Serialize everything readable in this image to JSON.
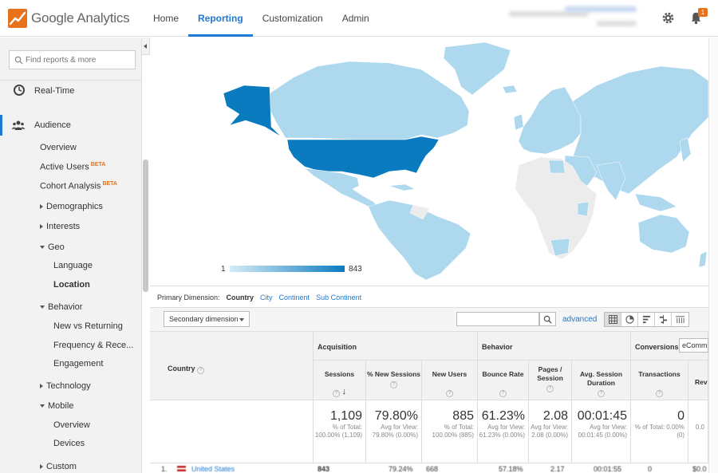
{
  "app": {
    "title": "Google Analytics"
  },
  "nav": {
    "home": "Home",
    "reporting": "Reporting",
    "customization": "Customization",
    "admin": "Admin"
  },
  "notifications": {
    "count": "1"
  },
  "sidebar": {
    "search_placeholder": "Find reports & more",
    "realtime": "Real-Time",
    "audience": "Audience",
    "overview": "Overview",
    "active_users": "Active Users",
    "cohort": "Cohort Analysis",
    "beta": "BETA",
    "demographics": "Demographics",
    "interests": "Interests",
    "geo": "Geo",
    "language": "Language",
    "location": "Location",
    "behavior": "Behavior",
    "new_vs_returning": "New vs Returning",
    "frequency": "Frequency & Rece...",
    "engagement": "Engagement",
    "technology": "Technology",
    "mobile": "Mobile",
    "mobile_overview": "Overview",
    "devices": "Devices",
    "custom": "Custom"
  },
  "map": {
    "legend_min": "1",
    "legend_max": "843",
    "color_high": "#0b7bc0",
    "color_low": "#add8ee",
    "color_none": "#ececec"
  },
  "dimensions": {
    "label": "Primary Dimension:",
    "current": "Country",
    "options": [
      "City",
      "Continent",
      "Sub Continent"
    ]
  },
  "toolbar": {
    "secondary": "Secondary dimension",
    "advanced": "advanced"
  },
  "table": {
    "country_header": "Country",
    "groups": {
      "acquisition": "Acquisition",
      "behavior": "Behavior",
      "conversions": "Conversions",
      "ecomm": "eComm"
    },
    "columns": {
      "sessions": "Sessions",
      "pct_new": "% New Sessions",
      "new_users": "New Users",
      "bounce": "Bounce Rate",
      "pages": "Pages / Session",
      "duration": "Avg. Session Duration",
      "transactions": "Transactions",
      "revenue": "Reve"
    },
    "totals": {
      "sessions": "1,109",
      "sessions_sub": "% of Total: 100.00% (1,109)",
      "pct_new": "79.80%",
      "pct_new_sub": "Avg for View: 79.80% (0.00%)",
      "new_users": "885",
      "new_users_sub": "% of Total: 100.00% (885)",
      "bounce": "61.23%",
      "bounce_sub": "Avg for View: 61.23% (0.00%)",
      "pages": "2.08",
      "pages_sub": "Avg for View: 2.08 (0.00%)",
      "duration": "00:01:45",
      "duration_sub": "Avg for View: 00:01:45 (0.00%)",
      "transactions": "0",
      "transactions_sub": "% of Total: 0.00% (0)",
      "revenue_sub": "0.0"
    },
    "row1": {
      "rank": "1.",
      "country": "United States",
      "sessions": "843",
      "pct_new": "79.24%",
      "new_users": "668",
      "bounce": "57.18%",
      "pages": "2.17",
      "duration": "00:01:55",
      "transactions": "0",
      "revenue": "$0.0"
    }
  }
}
